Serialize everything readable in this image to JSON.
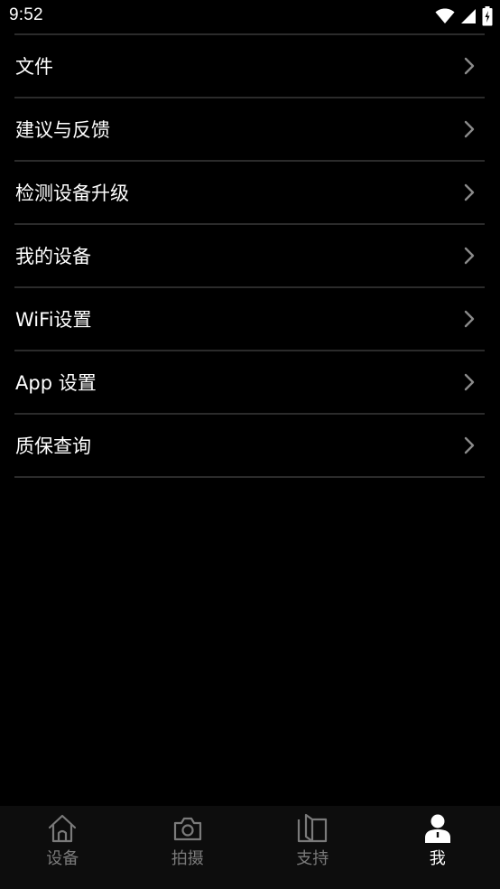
{
  "status_bar": {
    "time": "9:52",
    "icons": [
      "wifi-icon",
      "signal-icon",
      "battery-charging-icon"
    ]
  },
  "menu": {
    "items": [
      {
        "label": "文件",
        "icon": "chevron-right-icon"
      },
      {
        "label": "建议与反馈",
        "icon": "chevron-right-icon"
      },
      {
        "label": "检测设备升级",
        "icon": "chevron-right-icon"
      },
      {
        "label": "我的设备",
        "icon": "chevron-right-icon"
      },
      {
        "label": "WiFi设置",
        "icon": "chevron-right-icon"
      },
      {
        "label": "App 设置",
        "icon": "chevron-right-icon"
      },
      {
        "label": "质保查询",
        "icon": "chevron-right-icon"
      }
    ]
  },
  "tab_bar": {
    "tabs": [
      {
        "label": "设备",
        "icon": "home-icon",
        "active": false
      },
      {
        "label": "拍摄",
        "icon": "camera-icon",
        "active": false
      },
      {
        "label": "支持",
        "icon": "book-icon",
        "active": false
      },
      {
        "label": "我",
        "icon": "person-icon",
        "active": true
      }
    ]
  },
  "colors": {
    "background": "#000000",
    "divider": "#2b2b2b",
    "tab_bar_background": "#0d0d0d",
    "tab_inactive": "#7a7a7a",
    "tab_active": "#ffffff",
    "chevron": "#8a8a8a"
  }
}
